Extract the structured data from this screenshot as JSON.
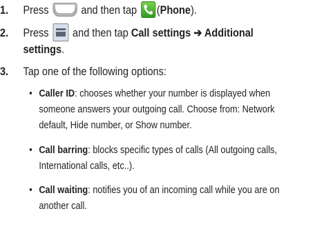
{
  "steps": [
    {
      "number": "1.",
      "text_1": "Press",
      "icon_1": "home-key-icon",
      "text_2": "and then tap",
      "icon_2": "phone-app-icon",
      "text_3": "(",
      "bold_1": "Phone",
      "text_4": ")."
    },
    {
      "number": "2.",
      "text_1": "Press",
      "icon_1": "menu-key-icon",
      "text_2": "and then tap",
      "bold_1": "Call settings ➔ Additional",
      "bold_2": "settings",
      "text_3": "."
    },
    {
      "number": "3.",
      "text_1": "Tap one of the following options:"
    }
  ],
  "options": [
    {
      "bullet": "•",
      "term": "Caller ID",
      "line_1": ": chooses whether your number is displayed when",
      "line_2": "someone answers your outgoing call. Choose from: Network",
      "line_3": "default, Hide number, or Show number."
    },
    {
      "bullet": "•",
      "term": "Call barring",
      "line_1": ": blocks specific types of calls (All outgoing calls,",
      "line_2": "International calls, etc..)."
    },
    {
      "bullet": "•",
      "term": "Call waiting",
      "line_1": ": notifies you of an incoming call while you are on",
      "line_2": "another call."
    }
  ],
  "colors": {
    "text": "#222222",
    "phone_icon_green": "#3fae2a",
    "menu_key_blue": "#d8e1ea"
  }
}
